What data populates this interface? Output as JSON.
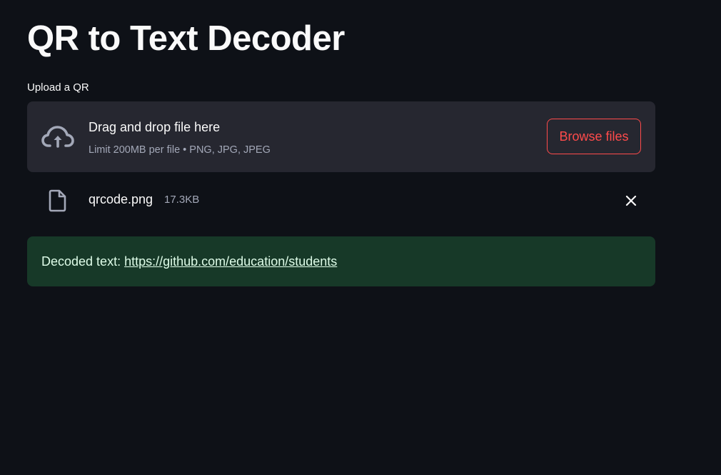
{
  "page": {
    "title": "QR to Text Decoder"
  },
  "uploader": {
    "label": "Upload a QR",
    "drop_title": "Drag and drop file here",
    "limit_text": "Limit 200MB per file • PNG, JPG, JPEG",
    "browse_label": "Browse files",
    "icon": "cloud-upload-icon"
  },
  "uploaded_file": {
    "name": "qrcode.png",
    "size": "17.3KB",
    "icon": "file-icon",
    "remove_icon": "close-icon"
  },
  "result": {
    "prefix": "Decoded text: ",
    "link_text": "https://github.com/education/students"
  },
  "colors": {
    "background": "#0e1117",
    "panel": "#262730",
    "accent": "#ff4b4b",
    "success_bg": "#173928",
    "success_text": "#dffde9"
  }
}
